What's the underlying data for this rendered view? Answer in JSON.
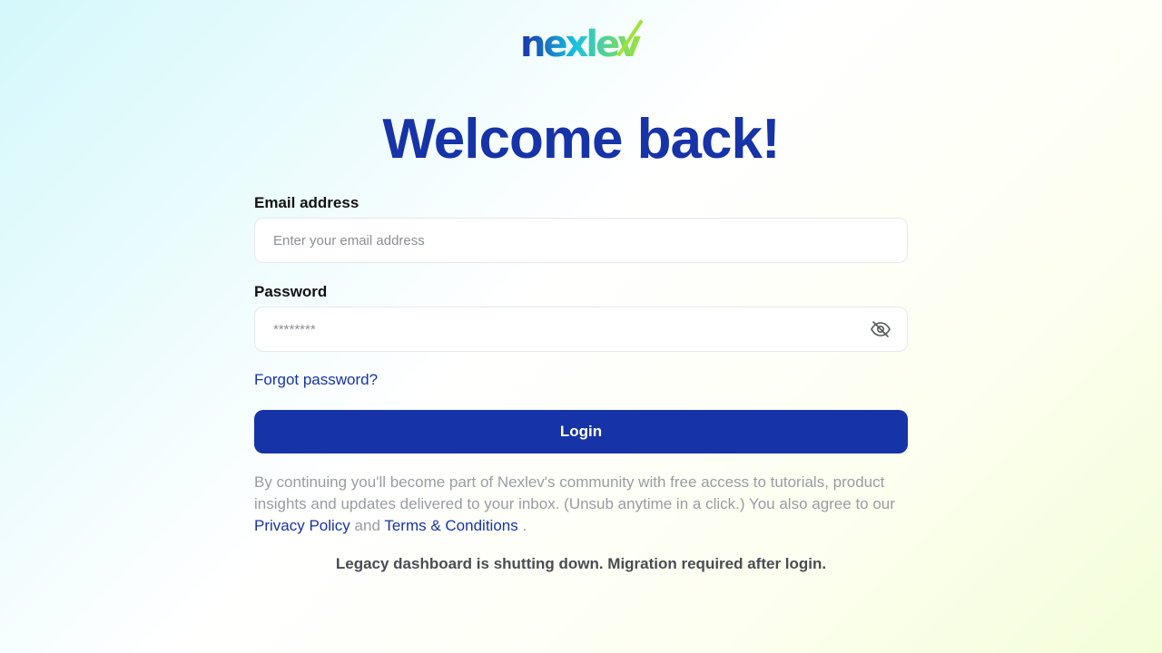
{
  "brand": {
    "logo_text": "nexlev",
    "colors": {
      "primary": "#1733a8",
      "logo_dark": "#1a2ea8",
      "logo_teal": "#17c2e0",
      "logo_green": "#9fe33a"
    }
  },
  "headline": "Welcome back!",
  "form": {
    "email": {
      "label": "Email address",
      "placeholder": "Enter your email address",
      "value": ""
    },
    "password": {
      "label": "Password",
      "placeholder": "********",
      "value": "",
      "toggle_icon": "eye-off-icon"
    },
    "forgot_link": "Forgot password?",
    "submit_label": "Login"
  },
  "disclaimer": {
    "text": "By continuing you'll become part of Nexlev's community with free access to tutorials, product insights and updates delivered to your inbox. (Unsub anytime in a click.) You also agree to our",
    "privacy_link": "Privacy Policy",
    "and": "and",
    "terms_link": "Terms & Conditions",
    "period": "."
  },
  "notice": "Legacy dashboard is shutting down. Migration required after login."
}
